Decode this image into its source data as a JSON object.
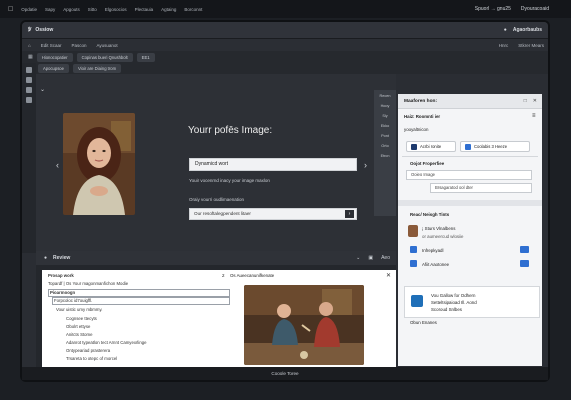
{
  "os_menu": [
    "Opdatie",
    "Sapy",
    "Apgouts",
    "Sitto",
    "Elgosocios",
    "Plectauia",
    "Agtaing",
    "Borconnt"
  ],
  "os_right": [
    "Spuorl → gnu25",
    "Dyouracoaid"
  ],
  "titlebar": {
    "title": "Ossiow",
    "right_label": "Agaorbaubs"
  },
  "menubar": [
    "Edit Scaar",
    "Pascon",
    "Ayusuanot"
  ],
  "menubar_right": [
    "Hnrc",
    "Stkrer Mears"
  ],
  "tabs": [
    "Hionocopatier",
    "Copinas bueri Qnushbolt",
    "EE1"
  ],
  "tab_buttons": [
    "Apocupsoe",
    "Vioir are Diaing trom"
  ],
  "editor": {
    "heading": "Yourr pofēs Image:",
    "input1_value": "Dynamicd wort",
    "desc_line": "Youir vocenrnd inacy your image maxlon",
    "label2": "Oraiy vourri oudlimaenation",
    "input2_value": "Our resoftalegpendent litaer",
    "go_label": "›"
  },
  "sidenav": [
    "Recen",
    "Hooy",
    "Sly",
    "Ekko",
    "Pont",
    "Orto",
    "Etrcn"
  ],
  "preview": {
    "title": "Review",
    "right_items": [
      "⌄",
      "▣",
      "Aeo"
    ],
    "tab2_label": "2",
    "tab2_text": "Os Aueecanunifkenate",
    "close": "✕",
    "doc_lines": [
      "Prosap work",
      "Topardf | Os Your magonmanfichon Modie",
      "Pioarmoogn",
      "Forpcoloc id7ouigffl.",
      "Vour uistic umy mbmmy.",
      "Cognsee ttecyts",
      "Obolrt ettyse",
      "Anitcts Stome",
      "Adanrot typeatlon tect Arnnt Camyexrlinge",
      "Ontypeariad prasterera",
      "Trsareta to otepc of morcel"
    ]
  },
  "right_panel": {
    "header": "Maaforen hon:",
    "header_right": [
      "□",
      "✕"
    ],
    "subhead": "Haiz: Roomnti ier",
    "menu_icon": "≡",
    "small_label": "yooyaltnicon",
    "btn1": "Acrbi ronite",
    "btn2": "Coolabis 3 Heeze",
    "section1": "Oojot Froperfiee",
    "field1": "Ooieo Image",
    "field2": "Brsagaratod ool dter",
    "section2": "Reac/ Neisgh Tints",
    "list": [
      {
        "icon": "portrait-thumb",
        "line1": "¡ Sturs Vlnalbens",
        "line2": "or aumeercud wlosiie"
      },
      {
        "icon": "blue-square",
        "line1": "Infrepkyadl",
        "line2": ""
      },
      {
        "icon": "blue-square",
        "line1": "Afiit Aaotonee",
        "line2": ""
      }
    ],
    "card_title": "Vou Gallow for Odhern",
    "card_line2": "Setteltsipaioad Ill. Aond",
    "card_line3": "Scoroud Snlbes",
    "footer": "Obun Enanes"
  },
  "statusbar": "Cooole Toree",
  "colors": {
    "accent": "#2f6fd1",
    "panel_bg": "#2d3036",
    "light_bg": "#f4f5f7"
  }
}
